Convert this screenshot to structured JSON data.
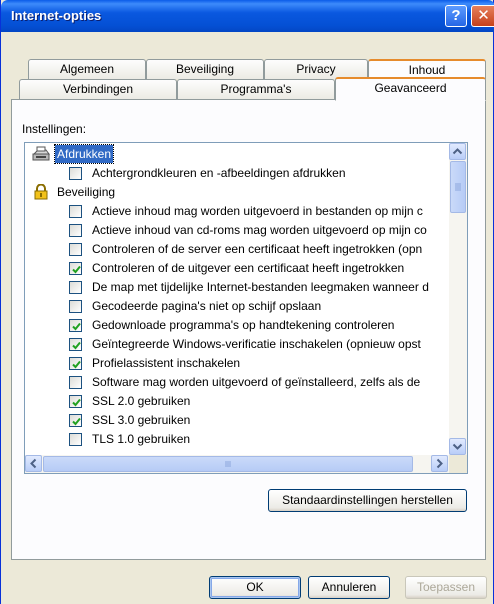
{
  "window": {
    "title": "Internet-opties",
    "help_glyph": "?",
    "close_glyph": "✕"
  },
  "tabs": {
    "row1": [
      "Algemeen",
      "Beveiliging",
      "Privacy",
      "Inhoud"
    ],
    "row2": [
      "Verbindingen",
      "Programma's",
      "Geavanceerd"
    ],
    "selected": "Geavanceerd"
  },
  "settings_label": "Instellingen:",
  "list": {
    "rows": [
      {
        "type": "category",
        "icon": "printer-icon",
        "label": "Afdrukken",
        "selected": true
      },
      {
        "type": "checkbox",
        "label": "Achtergrondkleuren en -afbeeldingen afdrukken",
        "checked": false
      },
      {
        "type": "category",
        "icon": "padlock-icon",
        "label": "Beveiliging",
        "selected": false
      },
      {
        "type": "checkbox",
        "label": "Actieve inhoud mag worden uitgevoerd in bestanden op mijn c",
        "checked": false
      },
      {
        "type": "checkbox",
        "label": "Actieve inhoud van cd-roms mag worden uitgevoerd op mijn co",
        "checked": false
      },
      {
        "type": "checkbox",
        "label": "Controleren of de server een certificaat heeft ingetrokken (opn",
        "checked": false
      },
      {
        "type": "checkbox",
        "label": "Controleren of de uitgever een certificaat heeft ingetrokken",
        "checked": true
      },
      {
        "type": "checkbox",
        "label": "De map met tijdelijke Internet-bestanden leegmaken wanneer d",
        "checked": false
      },
      {
        "type": "checkbox",
        "label": "Gecodeerde pagina's niet op schijf opslaan",
        "checked": false
      },
      {
        "type": "checkbox",
        "label": "Gedownloade programma's op handtekening controleren",
        "checked": true
      },
      {
        "type": "checkbox",
        "label": "Geïntegreerde Windows-verificatie inschakelen (opnieuw opst",
        "checked": true
      },
      {
        "type": "checkbox",
        "label": "Profielassistent inschakelen",
        "checked": true
      },
      {
        "type": "checkbox",
        "label": "Software mag worden uitgevoerd of geïnstalleerd, zelfs als de",
        "checked": false
      },
      {
        "type": "checkbox",
        "label": "SSL 2.0 gebruiken",
        "checked": true
      },
      {
        "type": "checkbox",
        "label": "SSL 3.0 gebruiken",
        "checked": true
      },
      {
        "type": "checkbox",
        "label": "TLS 1.0 gebruiken",
        "checked": false
      }
    ]
  },
  "buttons": {
    "restore": "Standaardinstellingen herstellen",
    "ok": "OK",
    "cancel": "Annuleren",
    "apply": "Toepassen"
  }
}
